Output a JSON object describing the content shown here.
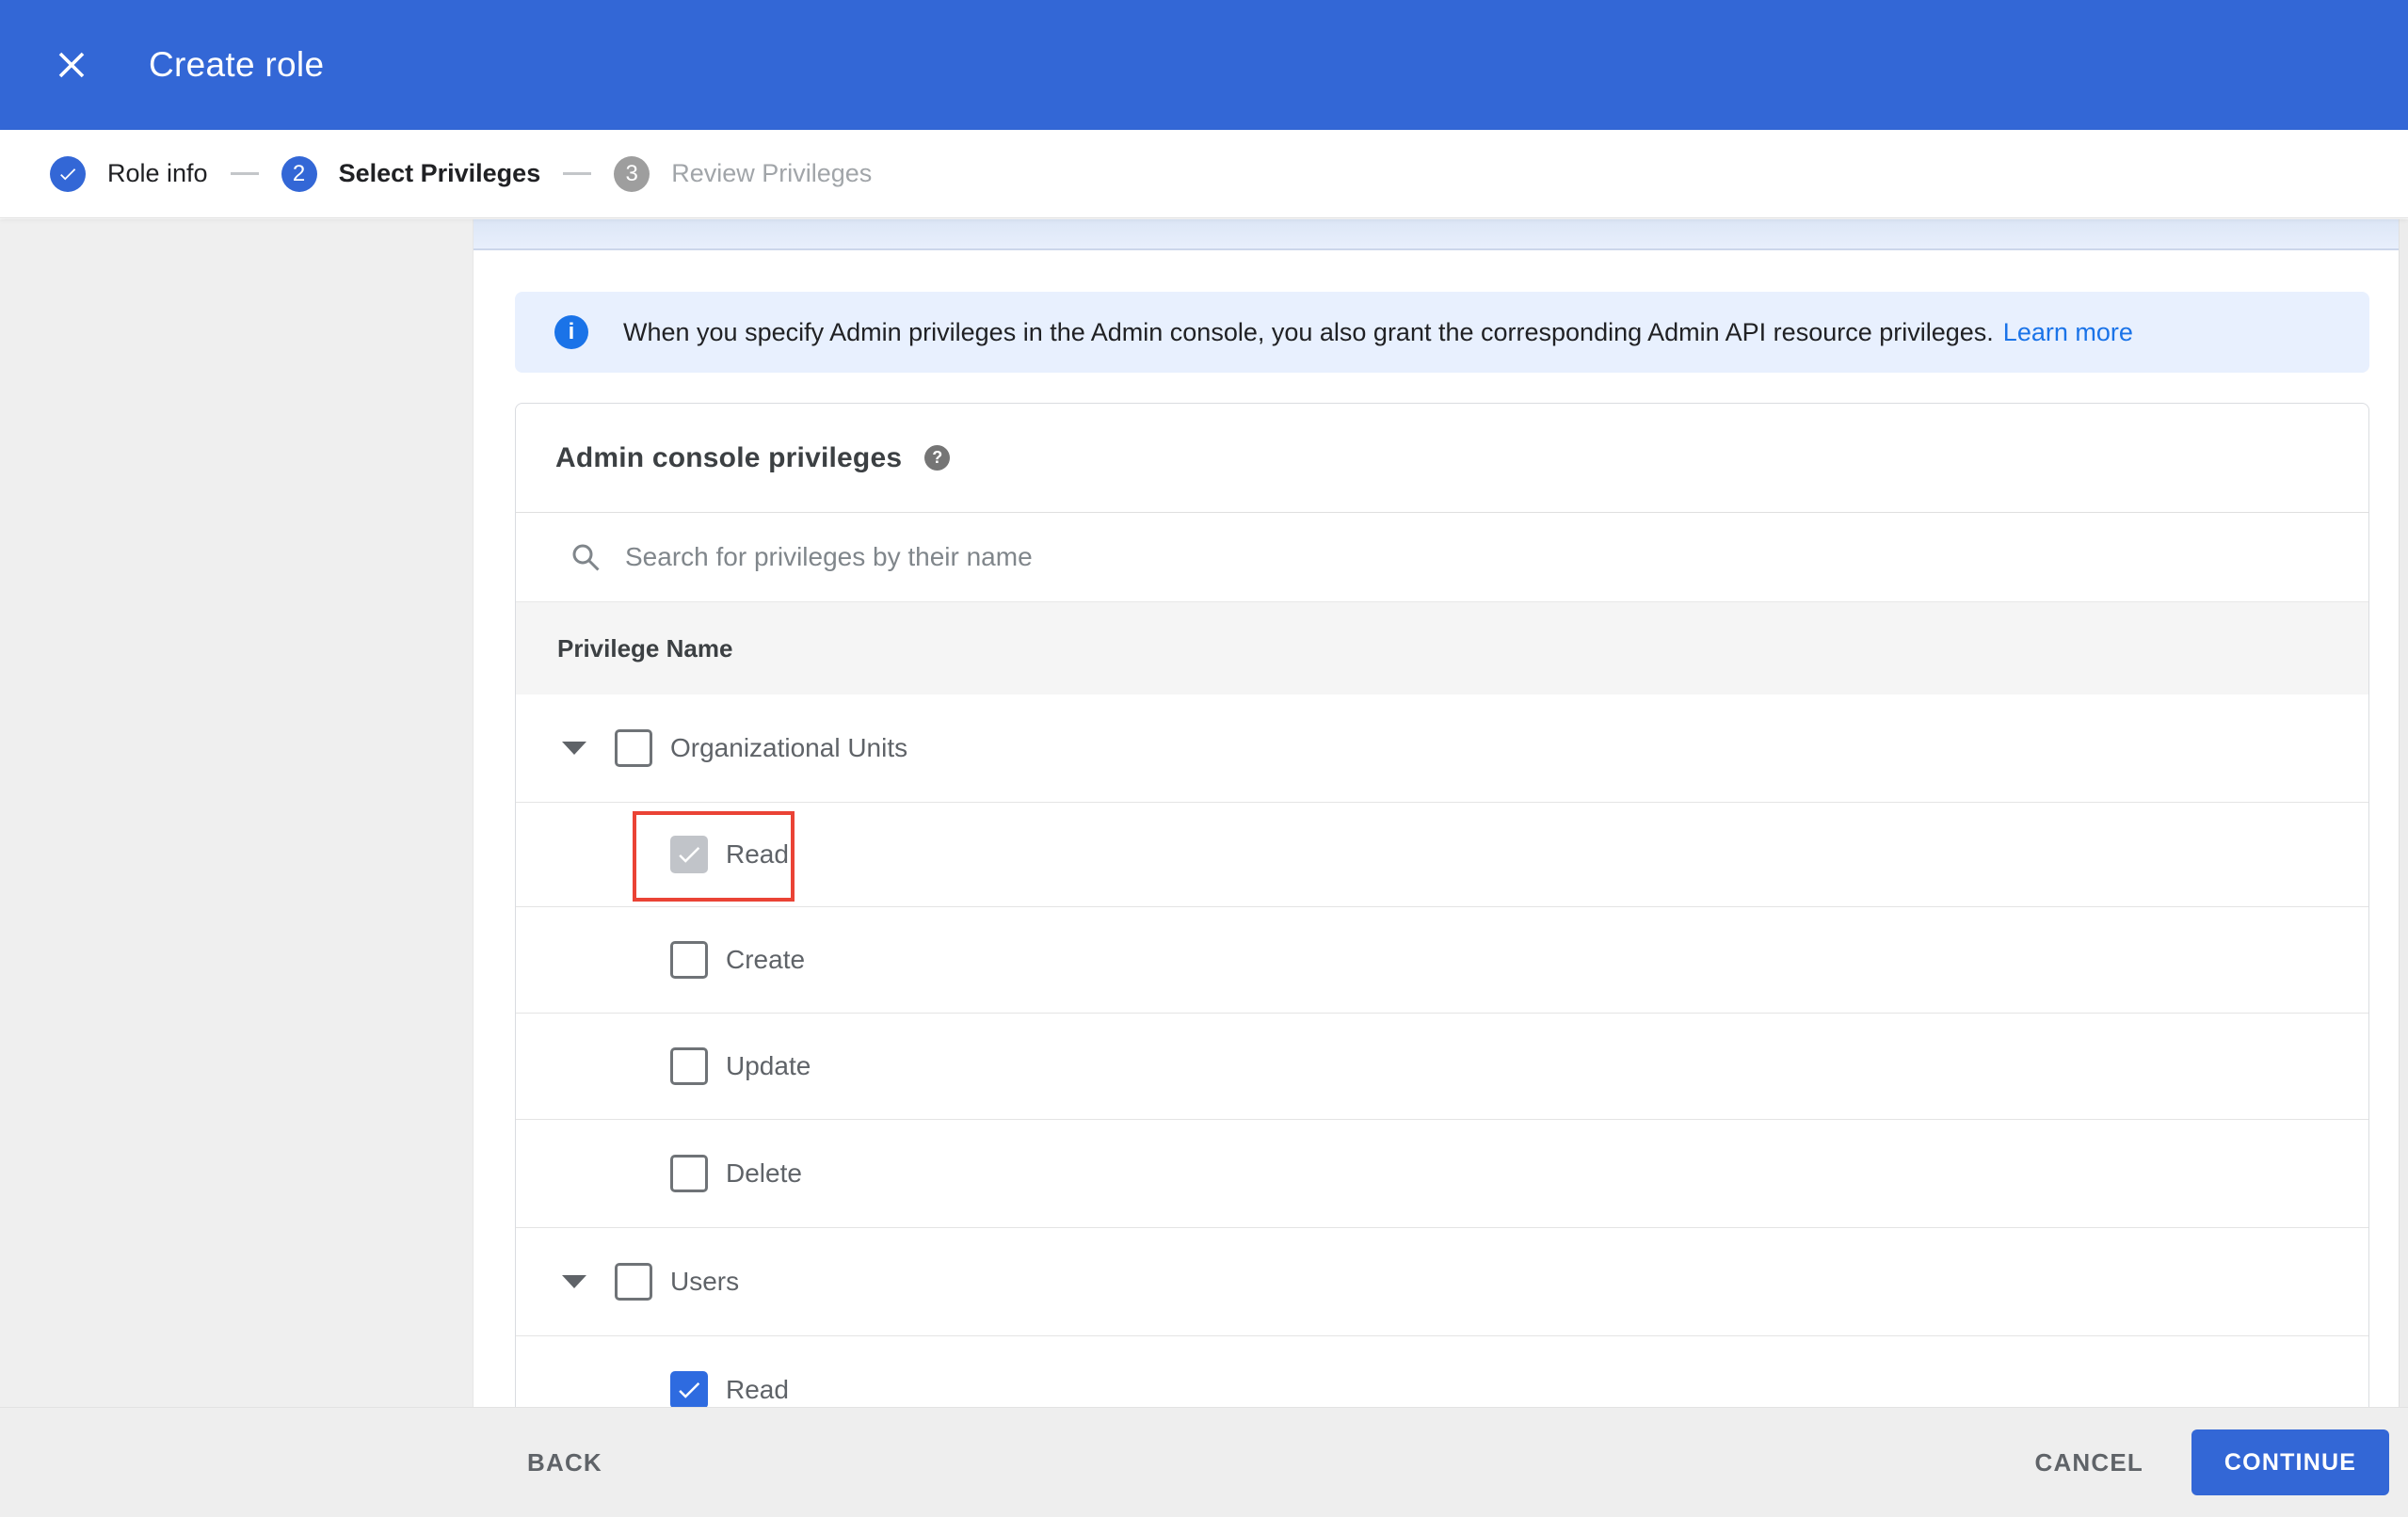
{
  "header": {
    "title": "Create role"
  },
  "stepper": {
    "steps": [
      {
        "label": "Role info",
        "state": "completed"
      },
      {
        "number": "2",
        "label": "Select Privileges",
        "state": "active"
      },
      {
        "number": "3",
        "label": "Review Privileges",
        "state": "upcoming"
      }
    ]
  },
  "banner": {
    "text": "When you specify Admin privileges in the Admin console, you also grant the corresponding Admin API resource privileges.",
    "link_label": "Learn more"
  },
  "card": {
    "title": "Admin console privileges",
    "search_placeholder": "Search for privileges by their name",
    "column_header": "Privilege Name",
    "rows": [
      {
        "type": "parent",
        "label": "Organizational Units",
        "checked": false,
        "expanded": true
      },
      {
        "type": "child",
        "label": "Read",
        "checked": true,
        "checkbox_style": "gray-checked",
        "highlighted": true
      },
      {
        "type": "child",
        "label": "Create",
        "checked": false
      },
      {
        "type": "child",
        "label": "Update",
        "checked": false
      },
      {
        "type": "child",
        "label": "Delete",
        "checked": false
      },
      {
        "type": "parent",
        "label": "Users",
        "checked": false,
        "expanded": true
      },
      {
        "type": "child",
        "label": "Read",
        "checked": true,
        "checkbox_style": "blue-checked",
        "clipped_by_footer": true
      }
    ]
  },
  "footer": {
    "back_label": "BACK",
    "cancel_label": "CANCEL",
    "continue_label": "CONTINUE"
  },
  "colors": {
    "header_blue": "#3367d6",
    "banner_bg": "#e8f0fe",
    "link_blue": "#1a73e8",
    "highlight_red": "#ea4335",
    "checked_gray_checkbox": "#c1c4c9",
    "checked_blue_checkbox": "#2e6be0",
    "footer_bg": "#eeeeee",
    "step_inactive_gray": "#9e9e9e"
  }
}
